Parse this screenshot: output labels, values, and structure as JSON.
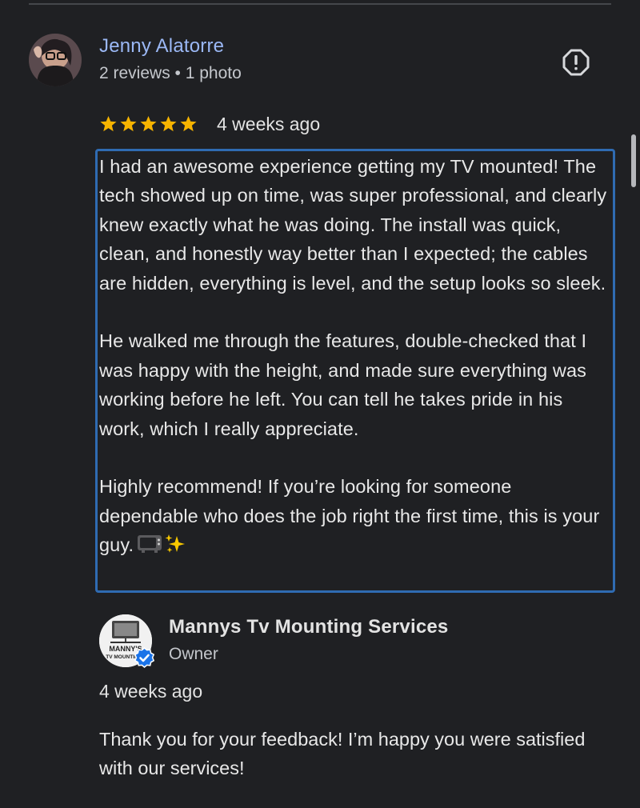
{
  "review": {
    "reviewer_name": "Jenny Alatorre",
    "reviewer_meta": "2 reviews • 1 photo",
    "rating": 5,
    "time": "4 weeks ago",
    "paragraphs": [
      "I had an awesome experience getting my TV mounted! The tech showed up on time, was super professional, and clearly knew exactly what he was doing. The install was quick, clean, and honestly way better than I expected; the cables are hidden, everything is level, and the setup looks so sleek.",
      "He walked me through the features, double-checked that I was happy with the height, and made sure everything was working before he left. You can tell he takes pride in his work, which I really appreciate.",
      "Highly recommend! If you’re looking for someone dependable who does the job right the first time, this is your guy."
    ]
  },
  "owner_response": {
    "name": "Mannys Tv Mounting Services",
    "role": "Owner",
    "avatar_text_top": "MANNY'S",
    "avatar_text_bottom": "TV MOUNTING",
    "time": "4 weeks ago",
    "text": "Thank you for your feedback! I’m happy you were satisfied with our services!"
  },
  "icons": {
    "report": "report-flag-icon",
    "star": "star-icon",
    "verified": "verified-check-icon"
  },
  "colors": {
    "background": "#1f2023",
    "reviewer_name": "#9bb8f5",
    "star": "#f6b400",
    "highlight_border": "#2f6bb2",
    "verified": "#1a73e8"
  }
}
